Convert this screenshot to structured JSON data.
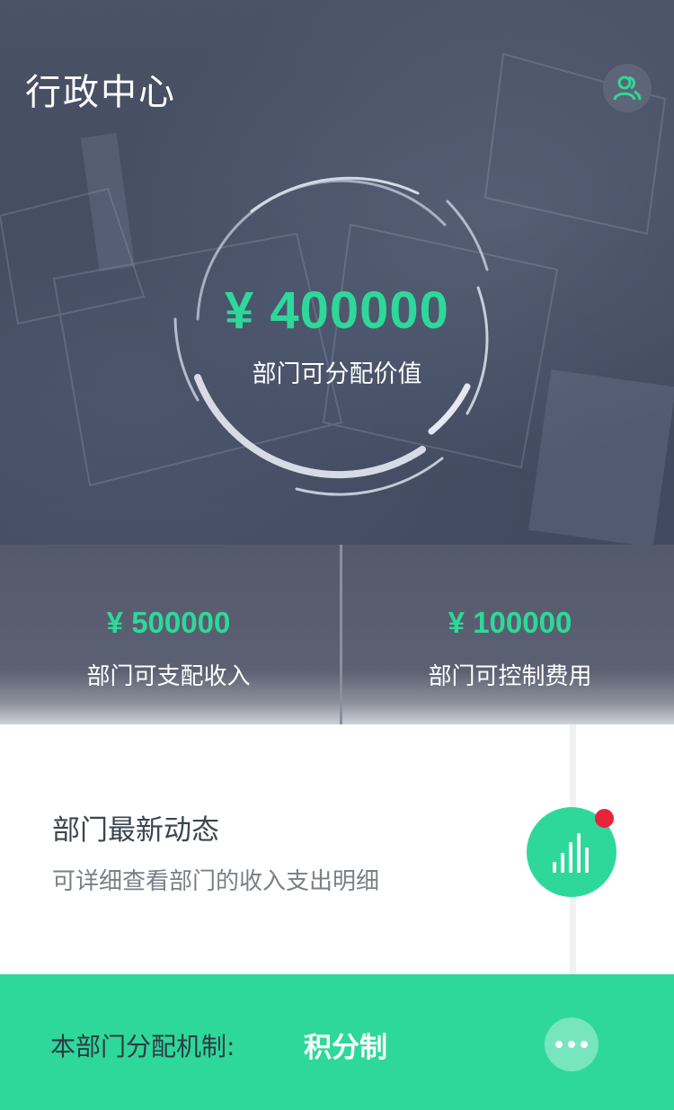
{
  "header": {
    "title": "行政中心",
    "user_icon": "users-icon"
  },
  "hero": {
    "amount": "¥ 400000",
    "label": "部门可分配价值"
  },
  "stats": [
    {
      "value": "¥ 500000",
      "label": "部门可支配收入"
    },
    {
      "value": "¥ 100000",
      "label": "部门可控制费用"
    }
  ],
  "news": {
    "title": "部门最新动态",
    "description": "可详细查看部门的收入支出明细",
    "icon": "bar-chart-icon"
  },
  "footer": {
    "label": "本部门分配机制:",
    "value": "积分制",
    "more_icon": "more-icon"
  },
  "colors": {
    "accent": "#2ed89a",
    "badge": "#e8243a",
    "hero_bg": "#444c60"
  }
}
